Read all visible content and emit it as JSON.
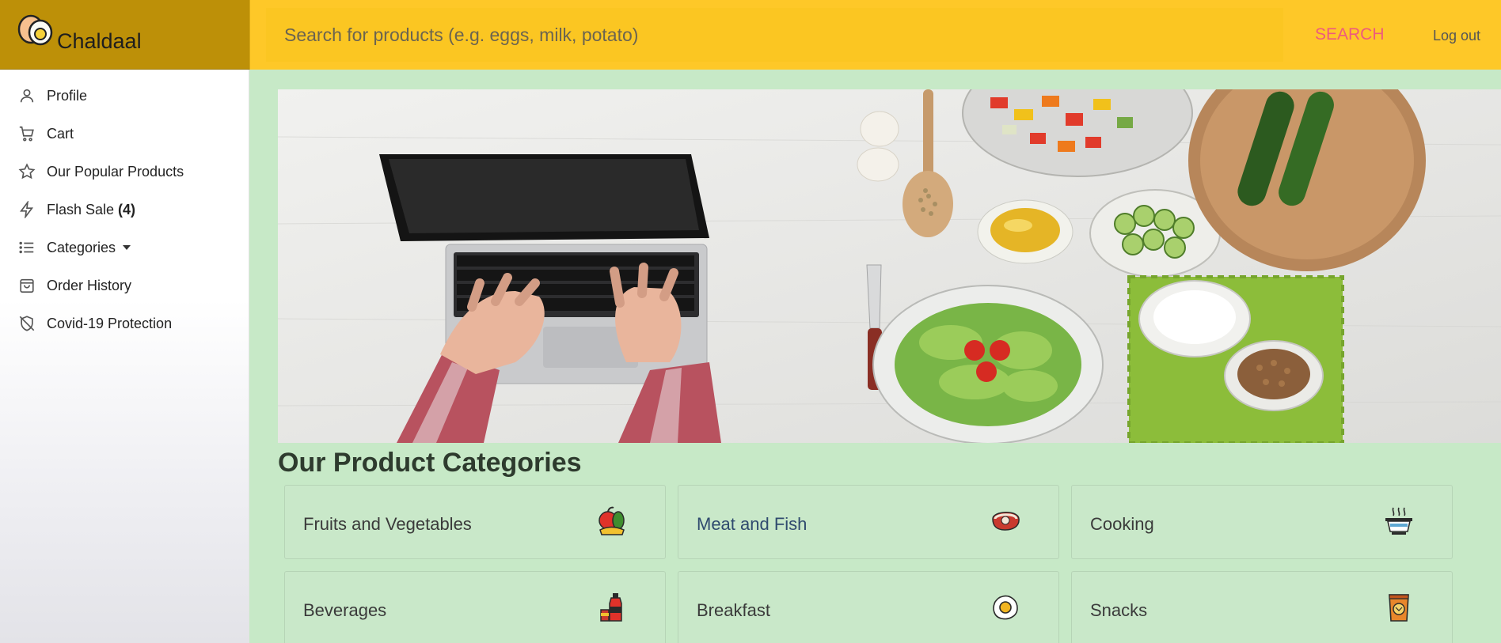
{
  "app": {
    "brand": "Chaldaal"
  },
  "header": {
    "search_placeholder": "Search for products (e.g. eggs, milk, potato)",
    "search_label": "SEARCH",
    "logout_label": "Log out"
  },
  "sidebar": {
    "items": [
      {
        "label": "Profile",
        "icon": "user-icon"
      },
      {
        "label": "Cart",
        "icon": "cart-icon"
      },
      {
        "label": "Our Popular Products",
        "icon": "star-icon"
      },
      {
        "label": "Flash Sale",
        "count": "(4)",
        "icon": "lightning-icon"
      },
      {
        "label": "Categories",
        "icon": "list-icon"
      },
      {
        "label": "Order History",
        "icon": "shopping-bag-icon"
      },
      {
        "label": "Covid-19 Protection",
        "icon": "shield-off-icon"
      }
    ]
  },
  "main": {
    "section_title": "Our Product Categories",
    "categories": [
      {
        "name": "Fruits and Vegetables",
        "icon": "fruits-vegetables-icon"
      },
      {
        "name": "Meat and Fish",
        "icon": "meat-icon"
      },
      {
        "name": "Cooking",
        "icon": "cooking-pot-icon"
      },
      {
        "name": "Beverages",
        "icon": "beverages-icon"
      },
      {
        "name": "Breakfast",
        "icon": "fried-egg-icon"
      },
      {
        "name": "Snacks",
        "icon": "snack-bag-icon"
      }
    ]
  },
  "colors": {
    "brand_bar": "#bd9008",
    "header_bar": "#fec828",
    "search_accent": "#ee5a7c",
    "main_background": "#c7e9c7"
  }
}
